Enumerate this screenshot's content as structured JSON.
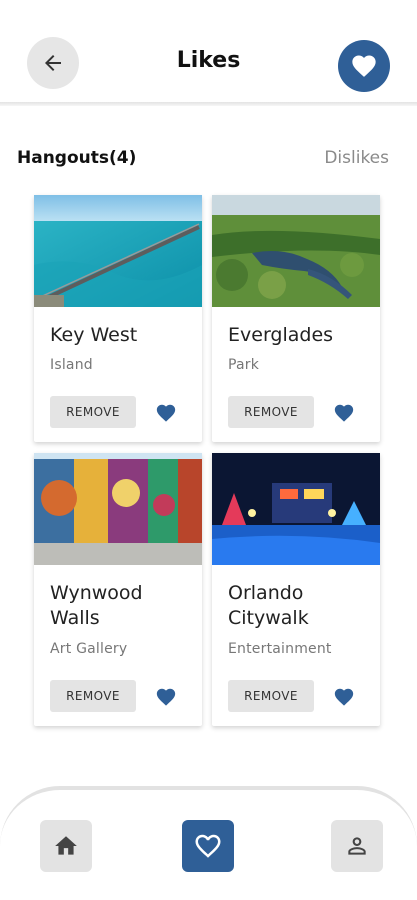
{
  "header": {
    "title": "Likes",
    "accent_color": "#2f5f97",
    "back_icon": "arrow-left-icon",
    "fav_icon": "heart-icon"
  },
  "section": {
    "title": "Hangouts(4)",
    "dislikes_label": "Dislikes"
  },
  "cards": [
    {
      "name": "Key West",
      "category": "Island",
      "remove_label": "REMOVE",
      "photo": "bridge-over-sea-photo"
    },
    {
      "name": "Everglades",
      "category": "Park",
      "remove_label": "REMOVE",
      "photo": "wetland-aerial-photo"
    },
    {
      "name": "Wynwood Walls",
      "category": "Art Gallery",
      "remove_label": "REMOVE",
      "photo": "street-mural-photo"
    },
    {
      "name": "Orlando Citywalk",
      "category": "Entertainment",
      "remove_label": "REMOVE",
      "photo": "night-lights-photo"
    }
  ],
  "bottom_nav": {
    "items": [
      {
        "icon": "home-icon",
        "active": false
      },
      {
        "icon": "heart-outline-icon",
        "active": true
      },
      {
        "icon": "person-icon",
        "active": false
      }
    ]
  }
}
